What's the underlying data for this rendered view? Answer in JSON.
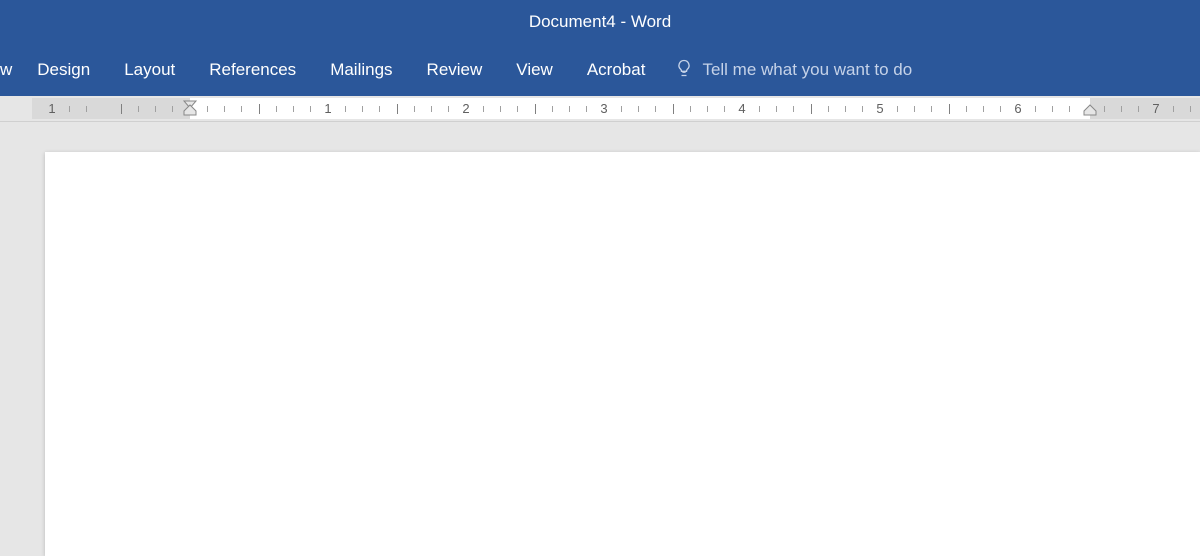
{
  "title": "Document4  -  Word",
  "tabs": {
    "partial": "w",
    "items": [
      "Design",
      "Layout",
      "References",
      "Mailings",
      "Review",
      "View",
      "Acrobat"
    ]
  },
  "tell_me": {
    "placeholder": "Tell me what you want to do"
  },
  "ruler": {
    "numbers": [
      "1",
      "1",
      "2",
      "3",
      "4",
      "5",
      "6",
      "7"
    ]
  }
}
